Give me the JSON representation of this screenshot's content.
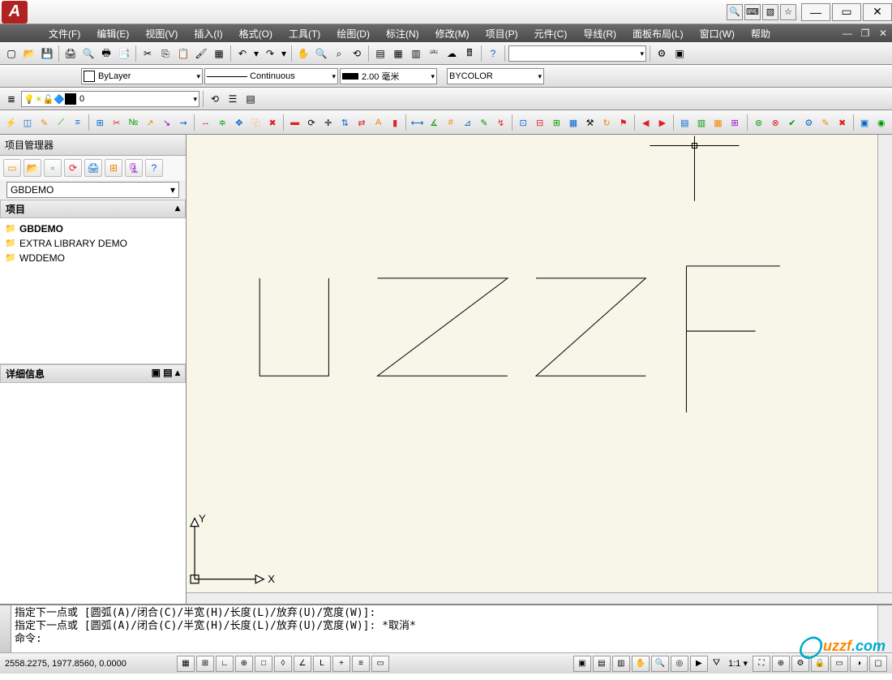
{
  "menu": [
    "文件(F)",
    "编辑(E)",
    "视图(V)",
    "插入(I)",
    "格式(O)",
    "工具(T)",
    "绘图(D)",
    "标注(N)",
    "修改(M)",
    "项目(P)",
    "元件(C)",
    "导线(R)",
    "面板布局(L)",
    "窗口(W)",
    "帮助"
  ],
  "props": {
    "layer": "ByLayer",
    "linetype": "Continuous",
    "lineweight": "2.00 毫米",
    "color": "BYCOLOR"
  },
  "layerbar": {
    "current": "0"
  },
  "pm": {
    "title": "项目管理器",
    "combo": "GBDEMO",
    "section": "项目",
    "items": [
      "GBDEMO",
      "EXTRA LIBRARY DEMO",
      "WDDEMO"
    ],
    "details": "详细信息"
  },
  "cmd": {
    "l1": "指定下一点或 [圆弧(A)/闭合(C)/半宽(H)/长度(L)/放弃(U)/宽度(W)]:",
    "l2": "指定下一点或 [圆弧(A)/闭合(C)/半宽(H)/长度(L)/放弃(U)/宽度(W)]: *取消*",
    "prompt": "命令:"
  },
  "status": {
    "coords": "2558.2275, 1977.8560, 0.0000",
    "scale": "1:1"
  },
  "canvas": {
    "y": "Y",
    "x": "X"
  },
  "watermark": {
    "brand": "uzzf",
    "tld": ".com"
  }
}
